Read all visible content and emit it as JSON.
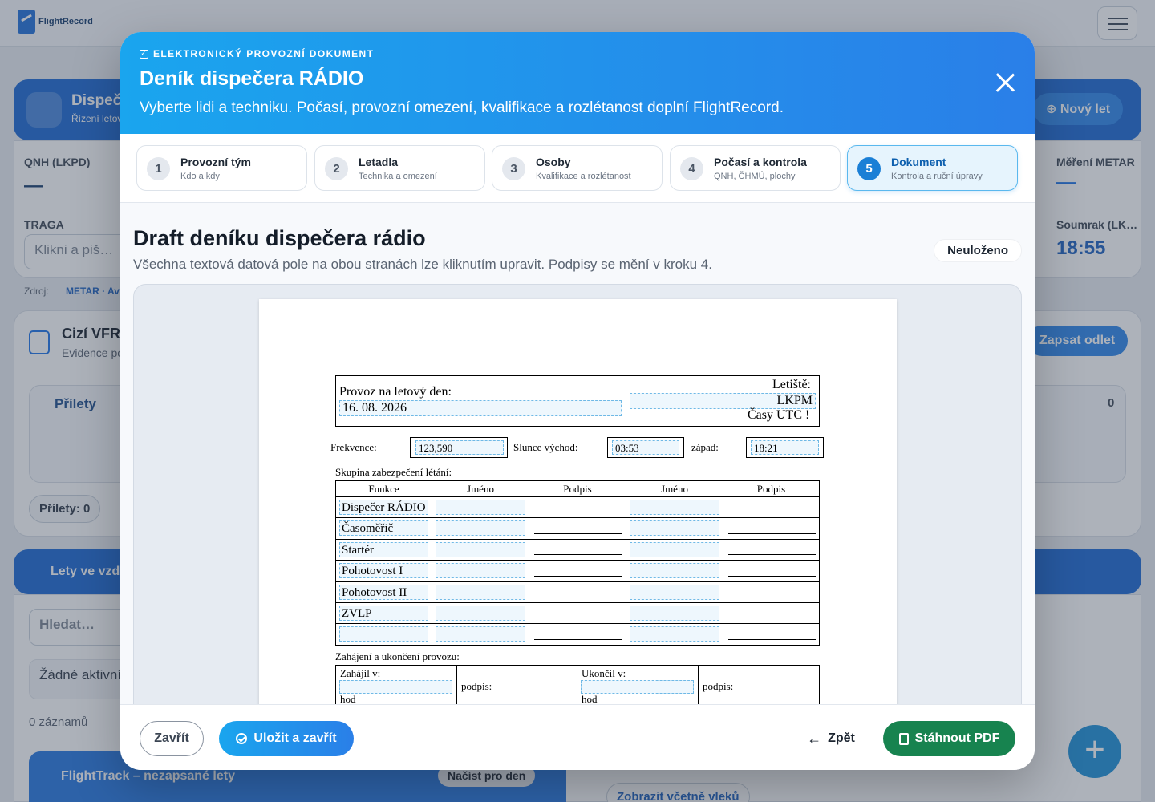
{
  "app": {
    "logo_text": "FlightRecord"
  },
  "background": {
    "dispatch_title": "Dispeč",
    "dispatch_sub": "Řízení letov",
    "new_flight": "Nový let",
    "qnh_label": "QNH (LKPD)",
    "qnh_value": "—",
    "metar_label": "Měření METAR",
    "metar_value": "—",
    "traga_label": "TRAGA",
    "traga_placeholder": "Klikni a piš…",
    "sources_label": "Zdroj:",
    "sources_value": "METAR · Avia",
    "dusk_label": "Soumrak (LK…",
    "dusk_value": "18:55",
    "foreign_title": "Cizí VFR",
    "foreign_sub": "Evidence po",
    "log_departure": "Zapsat odlet",
    "arrivals_title": "Přílety",
    "arrivals_count": "0",
    "arrivals_pill": "Přílety: 0",
    "flights_title": "Lety ve vzd",
    "search_placeholder": "Hledat…",
    "no_active": "Žádné aktivní",
    "records": "0 záznamů",
    "flighttrack": "FlightTrack – nezapsané lety",
    "load_day": "Načíst pro den",
    "show_towing": "Zobrazit včetně vleků"
  },
  "modal": {
    "eyebrow": "ELEKTRONICKÝ PROVOZNÍ DOKUMENT",
    "title": "Deník dispečera RÁDIO",
    "subtitle": "Vyberte lidi a techniku. Počasí, provozní omezení, kvalifikace a rozlétanost doplní FlightRecord.",
    "steps": [
      {
        "num": "1",
        "title": "Provozní tým",
        "desc": "Kdo a kdy"
      },
      {
        "num": "2",
        "title": "Letadla",
        "desc": "Technika a omezení"
      },
      {
        "num": "3",
        "title": "Osoby",
        "desc": "Kvalifikace a rozlétanost"
      },
      {
        "num": "4",
        "title": "Počasí a kontrola",
        "desc": "QNH, ČHMÚ, plochy"
      },
      {
        "num": "5",
        "title": "Dokument",
        "desc": "Kontrola a ruční úpravy"
      }
    ],
    "draft_title": "Draft deníku dispečera rádio",
    "draft_sub": "Všechna textová datová pole na obou stranách lze kliknutím upravit. Podpisy se mění v kroku 4.",
    "status_badge": "Neuloženo",
    "footer": {
      "close": "Zavřít",
      "save": "Uložit a zavřít",
      "back": "Zpět",
      "pdf": "Stáhnout PDF"
    }
  },
  "doc": {
    "day_label": "Provoz na letový den:",
    "day_value": "16. 08. 2026",
    "airport_label": "Letiště:",
    "airport_value": "LKPM",
    "utc_note": "Časy UTC !",
    "freq_label": "Frekvence:",
    "freq_value": "123,590",
    "sunrise_label": "Slunce východ:",
    "sunrise_value": "03:53",
    "sunset_label": "západ:",
    "sunset_value": "18:21",
    "group_label": "Skupina zabezpečení létání:",
    "columns": [
      "Funkce",
      "Jméno",
      "Podpis",
      "Jméno",
      "Podpis"
    ],
    "roles": [
      "Dispečer RÁDIO",
      "Časoměřič",
      "Startér",
      "Pohotovost I",
      "Pohotovost II",
      "ZVLP",
      ""
    ],
    "ops_label": "Zahájení a ukončení provozu:",
    "started_label": "Zahájil v:",
    "ended_label": "Ukončil v:",
    "sign_label": "podpis:",
    "hour_label": "hod"
  }
}
